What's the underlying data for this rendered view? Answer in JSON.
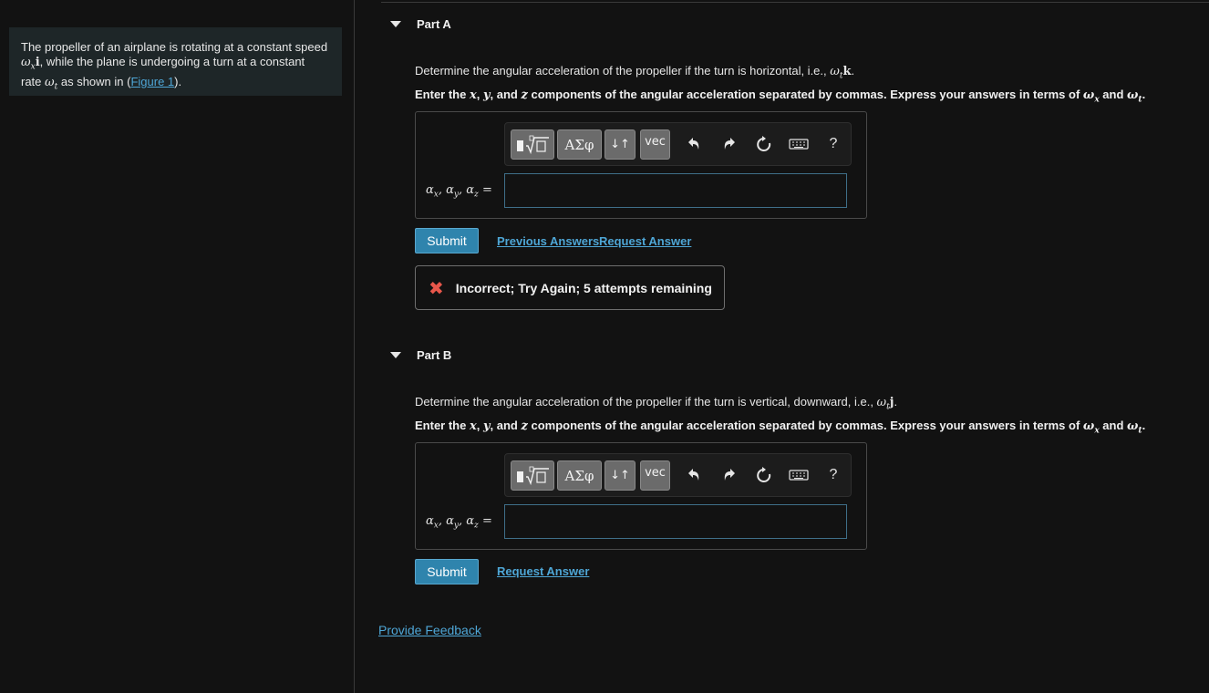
{
  "intro": {
    "line1": "The propeller of an airplane is rotating at a constant speed",
    "line2a": "ω",
    "line2sub": "x",
    "line2vec": "i",
    "line2b": ", while the plane is undergoing a turn at a constant",
    "line3a": "rate ",
    "line3omega": "ω",
    "line3sub": "t",
    "line3b": " as shown in (",
    "figure_link": "Figure 1",
    "line3c": ")."
  },
  "partA": {
    "title": "Part A",
    "question_pre": "Determine the angular acceleration of the propeller if the turn is horizontal, i.e., ",
    "question_omega": "ω",
    "question_sub": "t",
    "question_vec": "k",
    "question_post": ".",
    "instruction_pre": "Enter the ",
    "instruction_x": "x",
    "instruction_sep1": ", ",
    "instruction_y": "y",
    "instruction_sep2": ", and ",
    "instruction_z": "z",
    "instruction_mid": " components of the angular acceleration separated by commas. Express your answers in terms of ",
    "instruction_w1": "ω",
    "instruction_w1sub": "x",
    "instruction_and": " and ",
    "instruction_w2": "ω",
    "instruction_w2sub": "t",
    "instruction_end": ".",
    "input_label": "αx, αy, αz =",
    "input_value": "",
    "submit_label": "Submit",
    "previous_answers_label": "Previous Answers",
    "request_answer_label": "Request Answer",
    "feedback": "Incorrect; Try Again; 5 attempts remaining"
  },
  "partB": {
    "title": "Part B",
    "question_pre": "Determine the angular acceleration of the propeller if the turn is vertical, downward, i.e., ",
    "question_omega": "ω",
    "question_sub": "t",
    "question_vec": "j",
    "question_post": ".",
    "instruction_pre": "Enter the ",
    "instruction_x": "x",
    "instruction_sep1": ", ",
    "instruction_y": "y",
    "instruction_sep2": ", and ",
    "instruction_z": "z",
    "instruction_mid": " components of the angular acceleration separated by commas. Express your answers in terms of ",
    "instruction_w1": "ω",
    "instruction_w1sub": "x",
    "instruction_and": " and ",
    "instruction_w2": "ω",
    "instruction_w2sub": "t",
    "instruction_end": ".",
    "input_label": "αx, αy, αz =",
    "input_value": "",
    "submit_label": "Submit",
    "request_answer_label": "Request Answer"
  },
  "toolbar": {
    "symbols_label": "ΑΣφ",
    "arrows_label": "↓↑",
    "vec_label": "vec",
    "help_label": "?",
    "icons": [
      "templates-icon",
      "symbols-icon",
      "arrows-icon",
      "vec-icon",
      "undo-icon",
      "redo-icon",
      "reset-icon",
      "keyboard-icon",
      "help-icon"
    ]
  },
  "footer": {
    "provide_feedback": "Provide Feedback"
  },
  "colors": {
    "background": "#121212",
    "accent": "#2f84ad",
    "link": "#4ea6d6",
    "error": "#e8574b"
  }
}
